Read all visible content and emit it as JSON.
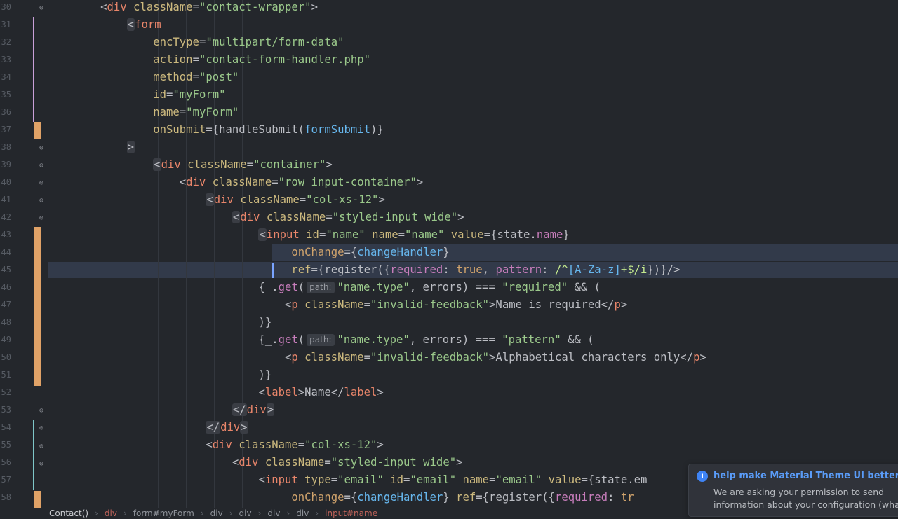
{
  "editor": {
    "highlight_color": "#323a4a",
    "change_color": "#e0a267",
    "lines": [
      {
        "num": "30",
        "tokens": [
          [
            "p",
            "        "
          ],
          [
            "p",
            "<"
          ],
          [
            "t",
            "div"
          ],
          [
            "a",
            " className"
          ],
          [
            "p",
            "="
          ],
          [
            "s",
            "\"contact-wrapper\""
          ],
          [
            "p",
            ">"
          ]
        ]
      },
      {
        "num": "31",
        "tokens": [
          [
            "p",
            "            "
          ],
          [
            "h",
            "<"
          ],
          [
            "t",
            "form"
          ]
        ]
      },
      {
        "num": "32",
        "tokens": [
          [
            "p",
            "                "
          ],
          [
            "a",
            "encType"
          ],
          [
            "p",
            "="
          ],
          [
            "s",
            "\"multipart/form-data\""
          ]
        ]
      },
      {
        "num": "33",
        "tokens": [
          [
            "p",
            "                "
          ],
          [
            "a",
            "action"
          ],
          [
            "p",
            "="
          ],
          [
            "s",
            "\"contact-form-handler.php\""
          ]
        ]
      },
      {
        "num": "34",
        "tokens": [
          [
            "p",
            "                "
          ],
          [
            "a",
            "method"
          ],
          [
            "p",
            "="
          ],
          [
            "s",
            "\"post\""
          ]
        ]
      },
      {
        "num": "35",
        "tokens": [
          [
            "p",
            "                "
          ],
          [
            "a",
            "id"
          ],
          [
            "p",
            "="
          ],
          [
            "s",
            "\"myForm\""
          ]
        ]
      },
      {
        "num": "36",
        "tokens": [
          [
            "p",
            "                "
          ],
          [
            "a",
            "name"
          ],
          [
            "p",
            "="
          ],
          [
            "s",
            "\"myForm\""
          ]
        ]
      },
      {
        "num": "37",
        "tokens": [
          [
            "p",
            "                "
          ],
          [
            "a",
            "onSubmit"
          ],
          [
            "p",
            "={handleSubmit("
          ],
          [
            "f",
            "formSubmit"
          ],
          [
            "p",
            ")}"
          ]
        ]
      },
      {
        "num": "38",
        "tokens": [
          [
            "p",
            "            "
          ],
          [
            "h",
            ">"
          ]
        ]
      },
      {
        "num": "39",
        "tokens": [
          [
            "p",
            "                "
          ],
          [
            "h",
            "<"
          ],
          [
            "t",
            "div"
          ],
          [
            "a",
            " className"
          ],
          [
            "p",
            "="
          ],
          [
            "s",
            "\"container\""
          ],
          [
            "p",
            ">"
          ]
        ]
      },
      {
        "num": "40",
        "tokens": [
          [
            "p",
            "                    "
          ],
          [
            "p",
            "<"
          ],
          [
            "t",
            "div"
          ],
          [
            "a",
            " className"
          ],
          [
            "p",
            "="
          ],
          [
            "s",
            "\"row input-container\""
          ],
          [
            "p",
            ">"
          ]
        ]
      },
      {
        "num": "41",
        "tokens": [
          [
            "p",
            "                        "
          ],
          [
            "h",
            "<"
          ],
          [
            "t",
            "div"
          ],
          [
            "a",
            " className"
          ],
          [
            "p",
            "="
          ],
          [
            "s",
            "\"col-xs-12\""
          ],
          [
            "p",
            ">"
          ]
        ]
      },
      {
        "num": "42",
        "tokens": [
          [
            "p",
            "                            "
          ],
          [
            "h",
            "<"
          ],
          [
            "t",
            "div"
          ],
          [
            "a",
            " className"
          ],
          [
            "p",
            "="
          ],
          [
            "s",
            "\"styled-input wide\""
          ],
          [
            "p",
            ">"
          ]
        ]
      },
      {
        "num": "43",
        "tokens": [
          [
            "p",
            "                                "
          ],
          [
            "h",
            "<"
          ],
          [
            "t",
            "input"
          ],
          [
            "a",
            " id"
          ],
          [
            "p",
            "="
          ],
          [
            "s",
            "\"name\""
          ],
          [
            "a",
            " name"
          ],
          [
            "p",
            "="
          ],
          [
            "s",
            "\"name\""
          ],
          [
            "a",
            " value"
          ],
          [
            "p",
            "={state."
          ],
          [
            "v",
            "name"
          ],
          [
            "p",
            "}"
          ]
        ]
      },
      {
        "num": "44",
        "tokens": [
          [
            "p",
            "                                     "
          ],
          [
            "k",
            "onChange"
          ],
          [
            "p",
            "={"
          ],
          [
            "f",
            "changeHandler"
          ],
          [
            "p",
            "}"
          ]
        ]
      },
      {
        "num": "45",
        "tokens": [
          [
            "p",
            "                                     "
          ],
          [
            "a",
            "ref"
          ],
          [
            "p",
            "={register({"
          ],
          [
            "v",
            "required"
          ],
          [
            "p",
            ": "
          ],
          [
            "k",
            "true"
          ],
          [
            "p",
            ", "
          ],
          [
            "v",
            "pattern"
          ],
          [
            "p",
            ": "
          ],
          [
            "r",
            "/^"
          ],
          [
            "f",
            "[A-Za-z]"
          ],
          [
            "r",
            "+$/i"
          ],
          [
            "p",
            "})}/>"
          ]
        ]
      },
      {
        "num": "46",
        "tokens": [
          [
            "p",
            "                                "
          ],
          [
            "p",
            "{_."
          ],
          [
            "v",
            "get"
          ],
          [
            "p",
            "("
          ],
          [
            "hint",
            "path:"
          ],
          [
            "s",
            "\"name.type\""
          ],
          [
            "p",
            ", errors) === "
          ],
          [
            "s",
            "\"required\""
          ],
          [
            "p",
            " && ("
          ]
        ]
      },
      {
        "num": "47",
        "tokens": [
          [
            "p",
            "                                    "
          ],
          [
            "p",
            "<"
          ],
          [
            "t",
            "p"
          ],
          [
            "a",
            " className"
          ],
          [
            "p",
            "="
          ],
          [
            "s",
            "\"invalid-feedback\""
          ],
          [
            "p",
            ">Name is required</"
          ],
          [
            "t",
            "p"
          ],
          [
            "p",
            ">"
          ]
        ]
      },
      {
        "num": "48",
        "tokens": [
          [
            "p",
            "                                "
          ],
          [
            "p",
            ")}"
          ]
        ]
      },
      {
        "num": "49",
        "tokens": [
          [
            "p",
            "                                "
          ],
          [
            "p",
            "{_."
          ],
          [
            "v",
            "get"
          ],
          [
            "p",
            "("
          ],
          [
            "hint",
            "path:"
          ],
          [
            "s",
            "\"name.type\""
          ],
          [
            "p",
            ", errors) === "
          ],
          [
            "s",
            "\"pattern\""
          ],
          [
            "p",
            " && ("
          ]
        ]
      },
      {
        "num": "50",
        "tokens": [
          [
            "p",
            "                                    "
          ],
          [
            "p",
            "<"
          ],
          [
            "t",
            "p"
          ],
          [
            "a",
            " className"
          ],
          [
            "p",
            "="
          ],
          [
            "s",
            "\"invalid-feedback\""
          ],
          [
            "p",
            ">Alphabetical characters only</"
          ],
          [
            "t",
            "p"
          ],
          [
            "p",
            ">"
          ]
        ]
      },
      {
        "num": "51",
        "tokens": [
          [
            "p",
            "                                "
          ],
          [
            "p",
            ")}"
          ]
        ]
      },
      {
        "num": "52",
        "tokens": [
          [
            "p",
            "                                "
          ],
          [
            "p",
            "<"
          ],
          [
            "t",
            "label"
          ],
          [
            "p",
            ">Name</"
          ],
          [
            "t",
            "label"
          ],
          [
            "p",
            ">"
          ]
        ]
      },
      {
        "num": "53",
        "tokens": [
          [
            "p",
            "                            "
          ],
          [
            "h",
            "</"
          ],
          [
            "t",
            "div"
          ],
          [
            "h",
            ">"
          ]
        ]
      },
      {
        "num": "54",
        "tokens": [
          [
            "p",
            "                        "
          ],
          [
            "h",
            "</"
          ],
          [
            "t",
            "div"
          ],
          [
            "h",
            ">"
          ]
        ]
      },
      {
        "num": "55",
        "tokens": [
          [
            "p",
            "                        "
          ],
          [
            "p",
            "<"
          ],
          [
            "t",
            "div"
          ],
          [
            "a",
            " className"
          ],
          [
            "p",
            "="
          ],
          [
            "s",
            "\"col-xs-12\""
          ],
          [
            "p",
            ">"
          ]
        ]
      },
      {
        "num": "56",
        "tokens": [
          [
            "p",
            "                            "
          ],
          [
            "p",
            "<"
          ],
          [
            "t",
            "div"
          ],
          [
            "a",
            " className"
          ],
          [
            "p",
            "="
          ],
          [
            "s",
            "\"styled-input wide\""
          ],
          [
            "p",
            ">"
          ]
        ]
      },
      {
        "num": "57",
        "tokens": [
          [
            "p",
            "                                "
          ],
          [
            "p",
            "<"
          ],
          [
            "t",
            "input"
          ],
          [
            "a",
            " type"
          ],
          [
            "p",
            "="
          ],
          [
            "s",
            "\"email\""
          ],
          [
            "a",
            " id"
          ],
          [
            "p",
            "="
          ],
          [
            "s",
            "\"email\""
          ],
          [
            "a",
            " name"
          ],
          [
            "p",
            "="
          ],
          [
            "s",
            "\"email\""
          ],
          [
            "a",
            " value"
          ],
          [
            "p",
            "={state.em"
          ]
        ]
      },
      {
        "num": "58",
        "tokens": [
          [
            "p",
            "                                     "
          ],
          [
            "k",
            "onChange"
          ],
          [
            "p",
            "={"
          ],
          [
            "f",
            "changeHandler"
          ],
          [
            "p",
            "} "
          ],
          [
            "a",
            "ref"
          ],
          [
            "p",
            "={register({"
          ],
          [
            "v",
            "required"
          ],
          [
            "p",
            ": "
          ],
          [
            "k",
            "tr"
          ]
        ]
      }
    ]
  },
  "breadcrumbs": [
    {
      "label": "Contact()",
      "kind": "sel"
    },
    {
      "label": "div",
      "kind": "tag"
    },
    {
      "label": "form#myForm",
      "kind": "plain"
    },
    {
      "label": "div",
      "kind": "plain"
    },
    {
      "label": "div",
      "kind": "plain"
    },
    {
      "label": "div",
      "kind": "plain"
    },
    {
      "label": "div",
      "kind": "plain"
    },
    {
      "label": "input#name",
      "kind": "tag"
    }
  ],
  "breadcrumb_separator": "›",
  "notification": {
    "icon": "info-icon",
    "icon_glyph": "i",
    "title": "help make Material Theme UI better",
    "body_line1": "We are asking your permission to send",
    "body_line2": "information about your configuration (what"
  }
}
